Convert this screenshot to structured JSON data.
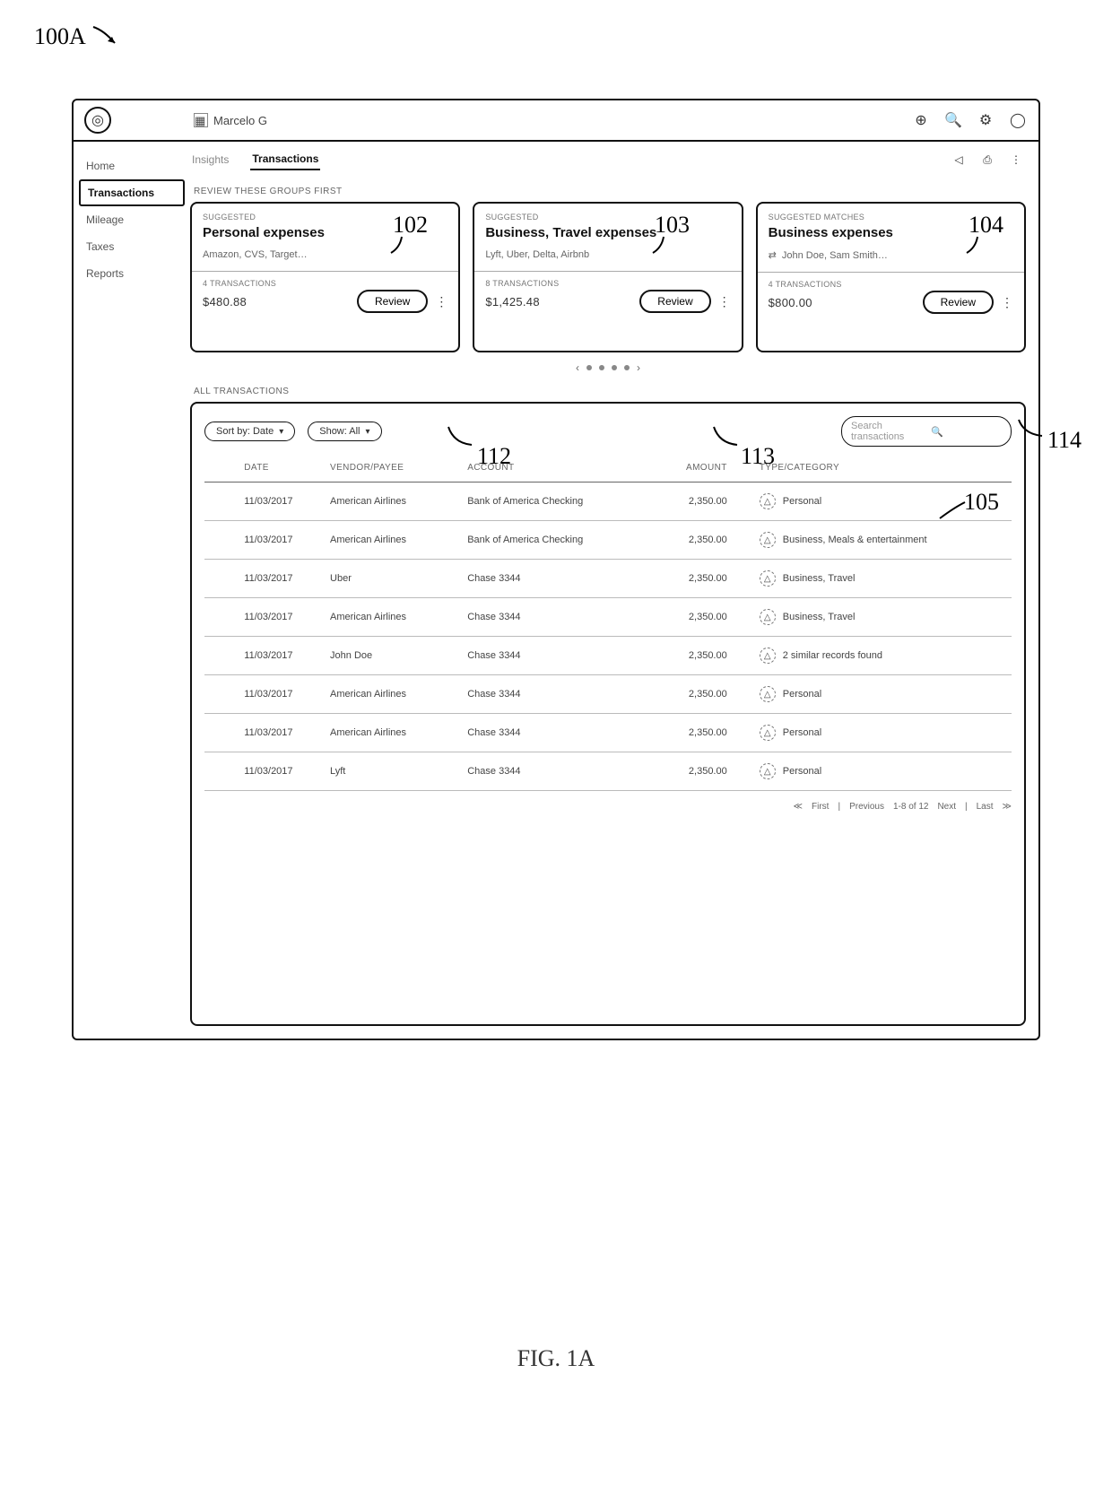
{
  "refs": {
    "figure_id": "100A",
    "caption": "FIG. 1A",
    "r102": "102",
    "r103": "103",
    "r104": "104",
    "r112": "112",
    "r113": "113",
    "r114": "114",
    "r105": "105"
  },
  "titlebar": {
    "brand_label": "Marcelo G"
  },
  "sidebar": {
    "items": [
      "Home",
      "Transactions",
      "Mileage",
      "Taxes",
      "Reports"
    ],
    "active_index": 1
  },
  "tabs": {
    "left": [
      "Insights",
      "Transactions"
    ],
    "active_index": 1
  },
  "review": {
    "section_label": "REVIEW THESE GROUPS FIRST",
    "cards": [
      {
        "kicker": "SUGGESTED",
        "title": "Personal expenses",
        "sub": "Amazon, CVS, Target…",
        "meta": "4 TRANSACTIONS",
        "amount": "$480.88",
        "action": "Review"
      },
      {
        "kicker": "SUGGESTED",
        "title": "Business, Travel expenses",
        "sub": "Lyft, Uber, Delta, Airbnb",
        "meta": "8 TRANSACTIONS",
        "amount": "$1,425.48",
        "action": "Review"
      },
      {
        "kicker": "SUGGESTED MATCHES",
        "title": "Business expenses",
        "sub": "John Doe, Sam Smith…",
        "meta": "4 TRANSACTIONS",
        "amount": "$800.00",
        "action": "Review"
      }
    ]
  },
  "tx": {
    "section_label": "ALL TRANSACTIONS",
    "sort_label": "Sort by: Date",
    "show_label": "Show: All",
    "search_placeholder": "Search transactions",
    "headers": {
      "date": "DATE",
      "vendor": "VENDOR/PAYEE",
      "account": "ACCOUNT",
      "amount": "AMOUNT",
      "type": "TYPE/CATEGORY"
    },
    "rows": [
      {
        "date": "11/03/2017",
        "vendor": "American Airlines",
        "account": "Bank of America Checking",
        "amount": "2,350.00",
        "type": "Personal"
      },
      {
        "date": "11/03/2017",
        "vendor": "American Airlines",
        "account": "Bank of America Checking",
        "amount": "2,350.00",
        "type": "Business, Meals & entertainment"
      },
      {
        "date": "11/03/2017",
        "vendor": "Uber",
        "account": "Chase 3344",
        "amount": "2,350.00",
        "type": "Business, Travel"
      },
      {
        "date": "11/03/2017",
        "vendor": "American Airlines",
        "account": "Chase 3344",
        "amount": "2,350.00",
        "type": "Business, Travel"
      },
      {
        "date": "11/03/2017",
        "vendor": "John Doe",
        "account": "Chase 3344",
        "amount": "2,350.00",
        "type": "2 similar records found"
      },
      {
        "date": "11/03/2017",
        "vendor": "American Airlines",
        "account": "Chase 3344",
        "amount": "2,350.00",
        "type": "Personal"
      },
      {
        "date": "11/03/2017",
        "vendor": "American Airlines",
        "account": "Chase 3344",
        "amount": "2,350.00",
        "type": "Personal"
      },
      {
        "date": "11/03/2017",
        "vendor": "Lyft",
        "account": "Chase 3344",
        "amount": "2,350.00",
        "type": "Personal"
      }
    ],
    "pager": {
      "first": "First",
      "prev": "Previous",
      "range": "1-8 of 12",
      "next": "Next",
      "last": "Last"
    }
  }
}
